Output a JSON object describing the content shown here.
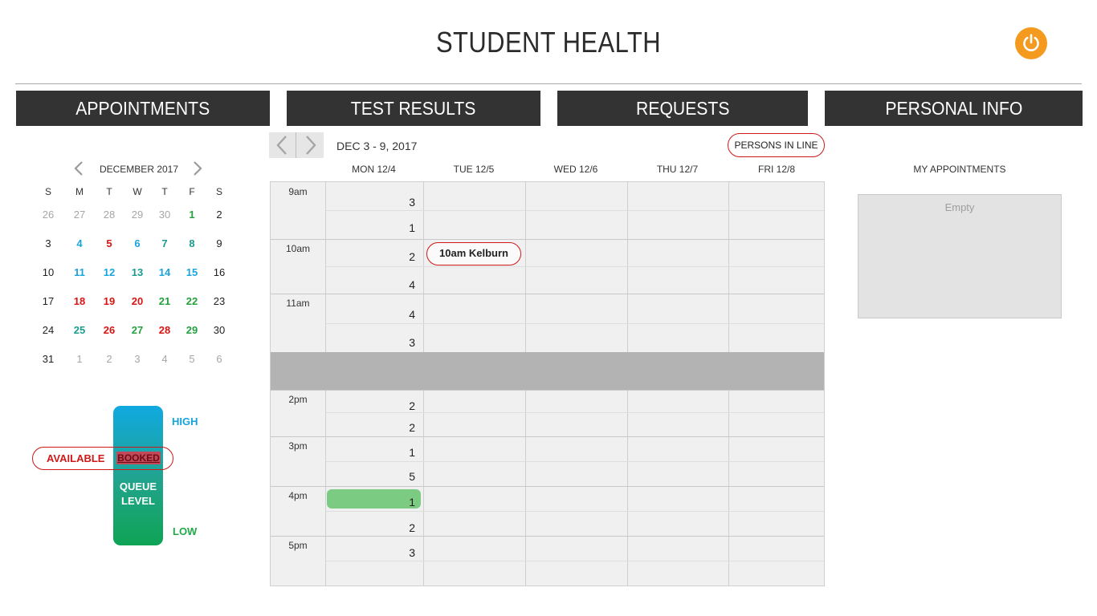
{
  "header": {
    "title": "STUDENT HEALTH",
    "power_icon": "power-icon",
    "accent": "#f39a1f"
  },
  "nav": [
    {
      "label": "APPOINTMENTS"
    },
    {
      "label": "TEST RESULTS"
    },
    {
      "label": "REQUESTS"
    },
    {
      "label": "PERSONAL INFO"
    }
  ],
  "calendar": {
    "month": "DECEMBER 2017",
    "prev_icon": "chevron-left-icon",
    "next_icon": "chevron-right-icon",
    "weekday_headers": [
      "S",
      "M",
      "T",
      "W",
      "T",
      "F",
      "S"
    ],
    "weeks": [
      [
        {
          "d": "26",
          "s": "muted"
        },
        {
          "d": "27",
          "s": "muted"
        },
        {
          "d": "28",
          "s": "muted"
        },
        {
          "d": "29",
          "s": "muted"
        },
        {
          "d": "30",
          "s": "muted"
        },
        {
          "d": "1",
          "s": "green"
        },
        {
          "d": "2",
          "s": "plain"
        }
      ],
      [
        {
          "d": "3",
          "s": "plain"
        },
        {
          "d": "4",
          "s": "blue"
        },
        {
          "d": "5",
          "s": "red"
        },
        {
          "d": "6",
          "s": "blue"
        },
        {
          "d": "7",
          "s": "teal"
        },
        {
          "d": "8",
          "s": "teal"
        },
        {
          "d": "9",
          "s": "plain"
        }
      ],
      [
        {
          "d": "10",
          "s": "plain"
        },
        {
          "d": "11",
          "s": "blue"
        },
        {
          "d": "12",
          "s": "blue"
        },
        {
          "d": "13",
          "s": "teal"
        },
        {
          "d": "14",
          "s": "blue"
        },
        {
          "d": "15",
          "s": "blue"
        },
        {
          "d": "16",
          "s": "plain"
        }
      ],
      [
        {
          "d": "17",
          "s": "plain"
        },
        {
          "d": "18",
          "s": "red"
        },
        {
          "d": "19",
          "s": "red"
        },
        {
          "d": "20",
          "s": "red"
        },
        {
          "d": "21",
          "s": "green"
        },
        {
          "d": "22",
          "s": "green"
        },
        {
          "d": "23",
          "s": "plain"
        }
      ],
      [
        {
          "d": "24",
          "s": "plain"
        },
        {
          "d": "25",
          "s": "teal"
        },
        {
          "d": "26",
          "s": "red"
        },
        {
          "d": "27",
          "s": "green"
        },
        {
          "d": "28",
          "s": "red"
        },
        {
          "d": "29",
          "s": "green"
        },
        {
          "d": "30",
          "s": "plain"
        }
      ],
      [
        {
          "d": "31",
          "s": "plain"
        },
        {
          "d": "1",
          "s": "muted"
        },
        {
          "d": "2",
          "s": "muted"
        },
        {
          "d": "3",
          "s": "muted"
        },
        {
          "d": "4",
          "s": "muted"
        },
        {
          "d": "5",
          "s": "muted"
        },
        {
          "d": "6",
          "s": "muted"
        }
      ]
    ],
    "colors": {
      "plain": "#222222",
      "muted": "#a6a6a6",
      "blue": "#1aa3dc",
      "teal": "#1b9b8e",
      "green": "#26a03f",
      "red": "#d81414"
    }
  },
  "queue": {
    "high": "HIGH",
    "low": "LOW",
    "level_line1": "QUEUE",
    "level_line2": "LEVEL",
    "available": "AVAILABLE",
    "booked": "BOOKED"
  },
  "schedule": {
    "prev_icon": "chevron-left-icon",
    "next_icon": "chevron-right-icon",
    "week_range": "DEC 3 - 9, 2017",
    "persons_in_line": "PERSONS IN LINE",
    "days": [
      "MON 12/4",
      "TUE 12/5",
      "WED 12/6",
      "THU 12/7",
      "FRI 12/8"
    ],
    "hours": [
      {
        "label": "9am",
        "counts": [
          "3",
          "1"
        ]
      },
      {
        "label": "10am",
        "counts": [
          "2",
          "4"
        ]
      },
      {
        "label": "11am",
        "counts": [
          "4",
          "3"
        ]
      },
      {
        "label": "2pm",
        "counts": [
          "2",
          "2"
        ]
      },
      {
        "label": "3pm",
        "counts": [
          "1",
          "5"
        ]
      },
      {
        "label": "4pm",
        "counts": [
          "1",
          "2"
        ]
      },
      {
        "label": "5pm",
        "counts": [
          "3",
          ""
        ]
      }
    ],
    "appointment": {
      "label": "10am Kelburn"
    },
    "selected_color": "#7ccb82"
  },
  "my_appointments": {
    "title": "MY APPOINTMENTS",
    "empty_text": "Empty"
  }
}
